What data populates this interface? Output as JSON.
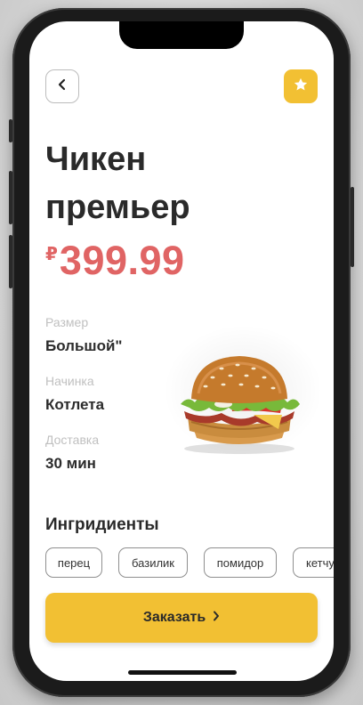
{
  "header": {
    "back_icon": "chevron-left-icon",
    "favorite_icon": "star-icon",
    "accent_color": "#f2c033"
  },
  "product": {
    "title_line1": "Чикен",
    "title_line2": "премьер",
    "currency": "₽",
    "price": "399.99",
    "price_color": "#e06464"
  },
  "specs": [
    {
      "label": "Размер",
      "value": "Большой\""
    },
    {
      "label": "Начинка",
      "value": "Котлета"
    },
    {
      "label": "Доставка",
      "value": "30 мин"
    }
  ],
  "ingredients": {
    "title": "Ингридиенты",
    "items": [
      "перец",
      "базилик",
      "помидор",
      "кетчуп"
    ]
  },
  "order_button": {
    "label": "Заказать",
    "icon": "chevron-right-icon"
  }
}
